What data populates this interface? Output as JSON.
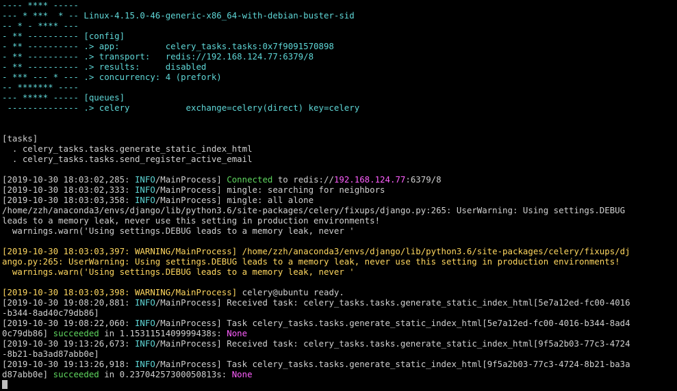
{
  "colors": {
    "background": "#000000",
    "default": "#d0d0d0",
    "cyan": "#5fd7d7",
    "green": "#5fd75f",
    "magenta": "#ff5fff",
    "yellow": "#ffd75f",
    "cursor": "#c0c0c0"
  },
  "terminal": {
    "lines": [
      {
        "segments": [
          {
            "text": "---- **** -----",
            "color": "cyan"
          }
        ]
      },
      {
        "segments": [
          {
            "text": "--- * ***  * -- Linux-4.15.0-46-generic-x86_64-with-debian-buster-sid",
            "color": "cyan"
          }
        ]
      },
      {
        "segments": [
          {
            "text": "-- * - **** ---",
            "color": "cyan"
          }
        ]
      },
      {
        "segments": [
          {
            "text": "- ** ---------- [config]",
            "color": "cyan"
          }
        ]
      },
      {
        "segments": [
          {
            "text": "- ** ---------- .> app:         celery_tasks.tasks:0x7f9091570898",
            "color": "cyan"
          }
        ]
      },
      {
        "segments": [
          {
            "text": "- ** ---------- .> transport:   redis://192.168.124.77:6379/8",
            "color": "cyan"
          }
        ]
      },
      {
        "segments": [
          {
            "text": "- ** ---------- .> results:     disabled",
            "color": "cyan"
          }
        ]
      },
      {
        "segments": [
          {
            "text": "- *** --- * --- .> concurrency: 4 (prefork)",
            "color": "cyan"
          }
        ]
      },
      {
        "segments": [
          {
            "text": "-- ******* ----",
            "color": "cyan"
          }
        ]
      },
      {
        "segments": [
          {
            "text": "--- ***** ----- [queues]",
            "color": "cyan"
          }
        ]
      },
      {
        "segments": [
          {
            "text": " -------------- .> celery           exchange=celery(direct) key=celery",
            "color": "cyan"
          }
        ]
      },
      {
        "segments": [
          {
            "text": "",
            "color": "default"
          }
        ]
      },
      {
        "segments": [
          {
            "text": "",
            "color": "default"
          }
        ]
      },
      {
        "segments": [
          {
            "text": "[tasks]",
            "color": "default"
          }
        ]
      },
      {
        "segments": [
          {
            "text": "  . celery_tasks.tasks.generate_static_index_html",
            "color": "default"
          }
        ]
      },
      {
        "segments": [
          {
            "text": "  . celery_tasks.tasks.send_register_active_email",
            "color": "default"
          }
        ]
      },
      {
        "segments": [
          {
            "text": "",
            "color": "default"
          }
        ]
      },
      {
        "segments": [
          {
            "text": "[2019-10-30 18:03:02,285: ",
            "color": "default"
          },
          {
            "text": "INFO",
            "color": "cyan"
          },
          {
            "text": "/MainProcess] ",
            "color": "default"
          },
          {
            "text": "Connected",
            "color": "green"
          },
          {
            "text": " to redis://",
            "color": "default"
          },
          {
            "text": "192.168.124.77",
            "color": "magenta"
          },
          {
            "text": ":6379/8",
            "color": "default"
          }
        ]
      },
      {
        "segments": [
          {
            "text": "[2019-10-30 18:03:02,333: ",
            "color": "default"
          },
          {
            "text": "INFO",
            "color": "cyan"
          },
          {
            "text": "/MainProcess] mingle: searching for neighbors",
            "color": "default"
          }
        ]
      },
      {
        "segments": [
          {
            "text": "[2019-10-30 18:03:03,358: ",
            "color": "default"
          },
          {
            "text": "INFO",
            "color": "cyan"
          },
          {
            "text": "/MainProcess] mingle: all alone",
            "color": "default"
          }
        ]
      },
      {
        "segments": [
          {
            "text": "/home/zzh/anaconda3/envs/django/lib/python3.6/site-packages/celery/fixups/django.py:265: UserWarning: Using settings.DEBUG",
            "color": "default"
          }
        ]
      },
      {
        "segments": [
          {
            "text": "leads to a memory leak, never use this setting in production environments!",
            "color": "default"
          }
        ]
      },
      {
        "segments": [
          {
            "text": "  warnings.warn('Using settings.DEBUG leads to a memory leak, never '",
            "color": "default"
          }
        ]
      },
      {
        "segments": [
          {
            "text": "",
            "color": "default"
          }
        ]
      },
      {
        "segments": [
          {
            "text": "[2019-10-30 18:03:03,397: WARNING/MainProcess] /home/zzh/anaconda3/envs/django/lib/python3.6/site-packages/celery/fixups/dj",
            "color": "yellow"
          }
        ]
      },
      {
        "segments": [
          {
            "text": "ango.py:265: UserWarning: Using settings.DEBUG leads to a memory leak, never use this setting in production environments!",
            "color": "yellow"
          }
        ]
      },
      {
        "segments": [
          {
            "text": "  warnings.warn('Using settings.DEBUG leads to a memory leak, never '",
            "color": "yellow"
          }
        ]
      },
      {
        "segments": [
          {
            "text": "",
            "color": "default"
          }
        ]
      },
      {
        "segments": [
          {
            "text": "[2019-10-30 18:03:03,398: WARNING/MainProcess] ",
            "color": "yellow"
          },
          {
            "text": "celery@ubuntu ready.",
            "color": "default"
          }
        ]
      },
      {
        "segments": [
          {
            "text": "[2019-10-30 19:08:20,881: ",
            "color": "default"
          },
          {
            "text": "INFO",
            "color": "cyan"
          },
          {
            "text": "/MainProcess] Received task: celery_tasks.tasks.generate_static_index_html[5e7a12ed-fc00-4016",
            "color": "default"
          }
        ]
      },
      {
        "segments": [
          {
            "text": "-b344-8ad40c79db86]",
            "color": "default"
          }
        ]
      },
      {
        "segments": [
          {
            "text": "[2019-10-30 19:08:22,060: ",
            "color": "default"
          },
          {
            "text": "INFO",
            "color": "cyan"
          },
          {
            "text": "/MainProcess] Task celery_tasks.tasks.generate_static_index_html[5e7a12ed-fc00-4016-b344-8ad4",
            "color": "default"
          }
        ]
      },
      {
        "segments": [
          {
            "text": "0c79db86] ",
            "color": "default"
          },
          {
            "text": "succeeded",
            "color": "green"
          },
          {
            "text": " in 1.1531151409999438s: ",
            "color": "default"
          },
          {
            "text": "None",
            "color": "magenta"
          }
        ]
      },
      {
        "segments": [
          {
            "text": "[2019-10-30 19:13:26,673: ",
            "color": "default"
          },
          {
            "text": "INFO",
            "color": "cyan"
          },
          {
            "text": "/MainProcess] Received task: celery_tasks.tasks.generate_static_index_html[9f5a2b03-77c3-4724",
            "color": "default"
          }
        ]
      },
      {
        "segments": [
          {
            "text": "-8b21-ba3ad87abb0e]",
            "color": "default"
          }
        ]
      },
      {
        "segments": [
          {
            "text": "[2019-10-30 19:13:26,918: ",
            "color": "default"
          },
          {
            "text": "INFO",
            "color": "cyan"
          },
          {
            "text": "/MainProcess] Task celery_tasks.tasks.generate_static_index_html[9f5a2b03-77c3-4724-8b21-ba3a",
            "color": "default"
          }
        ]
      },
      {
        "segments": [
          {
            "text": "d87abb0e] ",
            "color": "default"
          },
          {
            "text": "succeeded",
            "color": "green"
          },
          {
            "text": " in 0.23704257300050813s: ",
            "color": "default"
          },
          {
            "text": "None",
            "color": "magenta"
          }
        ]
      }
    ]
  }
}
